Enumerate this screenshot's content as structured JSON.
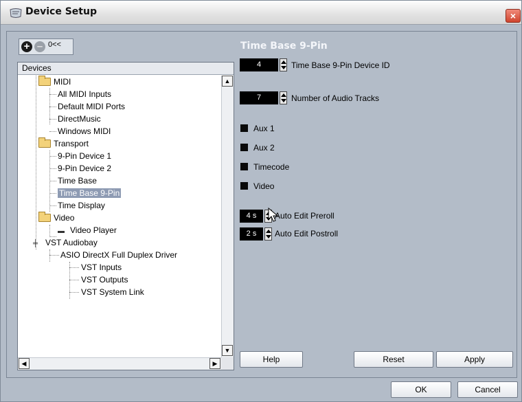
{
  "window": {
    "title": "Device Setup",
    "close_glyph": "×"
  },
  "toolbar": {
    "add_glyph": "+",
    "remove_glyph": "–",
    "reset_label": "0<<"
  },
  "tree": {
    "header": "Devices",
    "nodes": [
      {
        "label": "MIDI",
        "icon": "folder-icon"
      },
      {
        "label": "All MIDI Inputs"
      },
      {
        "label": "Default MIDI Ports"
      },
      {
        "label": "DirectMusic"
      },
      {
        "label": "Windows MIDI"
      },
      {
        "label": "Transport",
        "icon": "folder-icon"
      },
      {
        "label": "9-Pin Device 1"
      },
      {
        "label": "9-Pin Device 2"
      },
      {
        "label": "Time Base"
      },
      {
        "label": "Time Base 9-Pin",
        "selected": true
      },
      {
        "label": "Time Display"
      },
      {
        "label": "Video",
        "icon": "folder-icon"
      },
      {
        "label": "Video Player",
        "icon": "video-card-icon"
      },
      {
        "label": "VST Audiobay",
        "icon": "audiobay-icon"
      },
      {
        "label": "ASIO DirectX Full Duplex Driver"
      },
      {
        "label": "VST Inputs"
      },
      {
        "label": "VST Outputs"
      },
      {
        "label": "VST System Link"
      }
    ]
  },
  "panel": {
    "heading": "Time Base 9-Pin",
    "device_id": {
      "value": "4",
      "label": "Time Base 9-Pin Device ID"
    },
    "audio_tracks": {
      "value": "7",
      "label": "Number of Audio Tracks"
    },
    "checkboxes": [
      {
        "label": "Aux 1",
        "checked": false
      },
      {
        "label": "Aux 2",
        "checked": false
      },
      {
        "label": "Timecode",
        "checked": false
      },
      {
        "label": "Video",
        "checked": false
      }
    ],
    "preroll": {
      "value": "4 s",
      "label": "Auto Edit Preroll"
    },
    "postroll": {
      "value": "2 s",
      "label": "Auto Edit Postroll"
    }
  },
  "buttons": {
    "help": "Help",
    "reset": "Reset",
    "apply": "Apply",
    "ok": "OK",
    "cancel": "Cancel"
  },
  "colors": {
    "dialog_bg": "#b3bcc8",
    "selection": "#8e9bb3",
    "heading": "#f4f6fa"
  }
}
